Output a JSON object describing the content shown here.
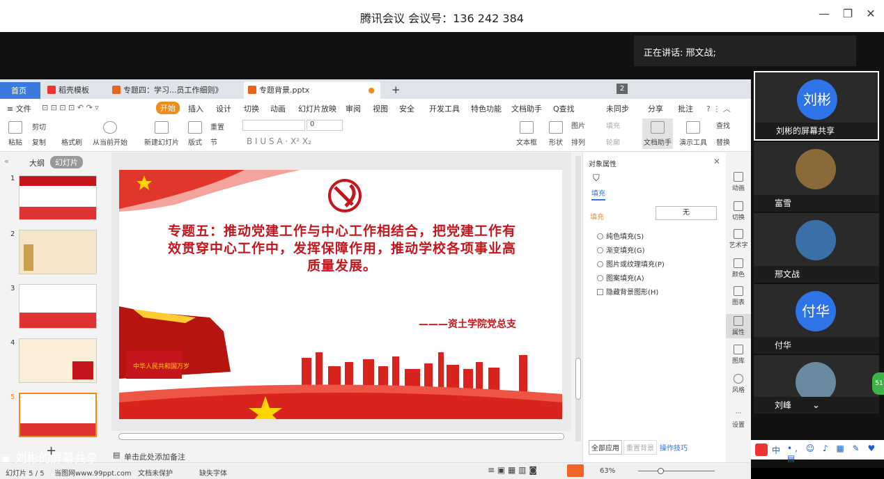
{
  "window": {
    "title": "腾讯会议 会议号：136 242 384",
    "minimize": "—",
    "restore": "❐",
    "close": "✕"
  },
  "speaker_banner": "正在讲话: 邢文战;",
  "wps": {
    "tabs": [
      {
        "label": "首页"
      },
      {
        "label": "稻壳模板"
      },
      {
        "label": "专题四：学习...员工作细则》"
      },
      {
        "label": "专题背景.pptx"
      }
    ],
    "tab_count": "2",
    "new_tab": "+",
    "menu": [
      "≡ 文件",
      "开始",
      "插入",
      "设计",
      "切换",
      "动画",
      "幻灯片放映",
      "审阅",
      "视图",
      "安全",
      "开发工具",
      "特色功能",
      "文档助手",
      "Q查找"
    ],
    "menu_right": [
      "未同步",
      "分享",
      "批注"
    ],
    "ribbon": {
      "paste": "粘贴",
      "cut": "剪切",
      "copy": "复制",
      "format_painter": "格式刷",
      "play_from_current": "从当前开始",
      "new_slide": "新建幻灯片",
      "layout": "版式",
      "section": "节",
      "reset": "重置",
      "font_size": "0",
      "text_box": "文本框",
      "shape": "形状",
      "arrange": "排列",
      "image": "图片",
      "fill": "填充",
      "outline": "轮廓",
      "doc_assistant": "文档助手",
      "present_tools": "演示工具",
      "find": "查找",
      "replace": "替换"
    },
    "left_panel": {
      "tab_outline": "大纲",
      "tab_slides": "幻灯片",
      "slide_numbers": [
        "1",
        "2",
        "3",
        "4",
        "5"
      ],
      "add": "+"
    },
    "slide": {
      "title": "专题五：推动党建工作与中心工作相结合，把党建工作有效贯穿中心工作中，发挥保障作用，推动学校各项事业高质量发展。",
      "subtitle": "———资土学院党总支",
      "banner_text": "中华人民共和国万岁"
    },
    "notes_placeholder": "单击此处添加备注",
    "props_panel": {
      "title": "对象属性",
      "tab_fill": "填充",
      "fill_label": "填充",
      "fill_value": "无",
      "options": [
        "纯色填充(S)",
        "渐变填充(G)",
        "图片或纹理填充(P)",
        "图案填充(A)",
        "隐藏背景图形(H)"
      ],
      "apply_all": "全部应用",
      "reset_bg": "重置背景",
      "tips": "操作技巧"
    },
    "right_toolbar": [
      "动画",
      "切换",
      "艺术字",
      "颜色",
      "图表",
      "属性",
      "图库",
      "风格",
      "设置"
    ],
    "statusbar": {
      "slide_info": "幻灯片 5 / 5",
      "theme": "当图网www.99ppt.com",
      "unprotected": "文档未保护",
      "missing_font": "缺失字体",
      "zoom": "63%"
    }
  },
  "participants": [
    {
      "name": "刘彬的屏幕共享",
      "avatar_text": "刘彬"
    },
    {
      "name": "富雪",
      "avatar_text": ""
    },
    {
      "name": "邢文战",
      "avatar_text": ""
    },
    {
      "name": "付华",
      "avatar_text": "付华"
    },
    {
      "name": "刘峰",
      "avatar_text": ""
    }
  ],
  "bottom_label": "刘彬的屏幕共享",
  "side_badge": "51",
  "ime_label": "中",
  "colors": {
    "accent_blue": "#2f74e6",
    "wps_orange": "#f08b1c",
    "party_red": "#c4161c"
  }
}
